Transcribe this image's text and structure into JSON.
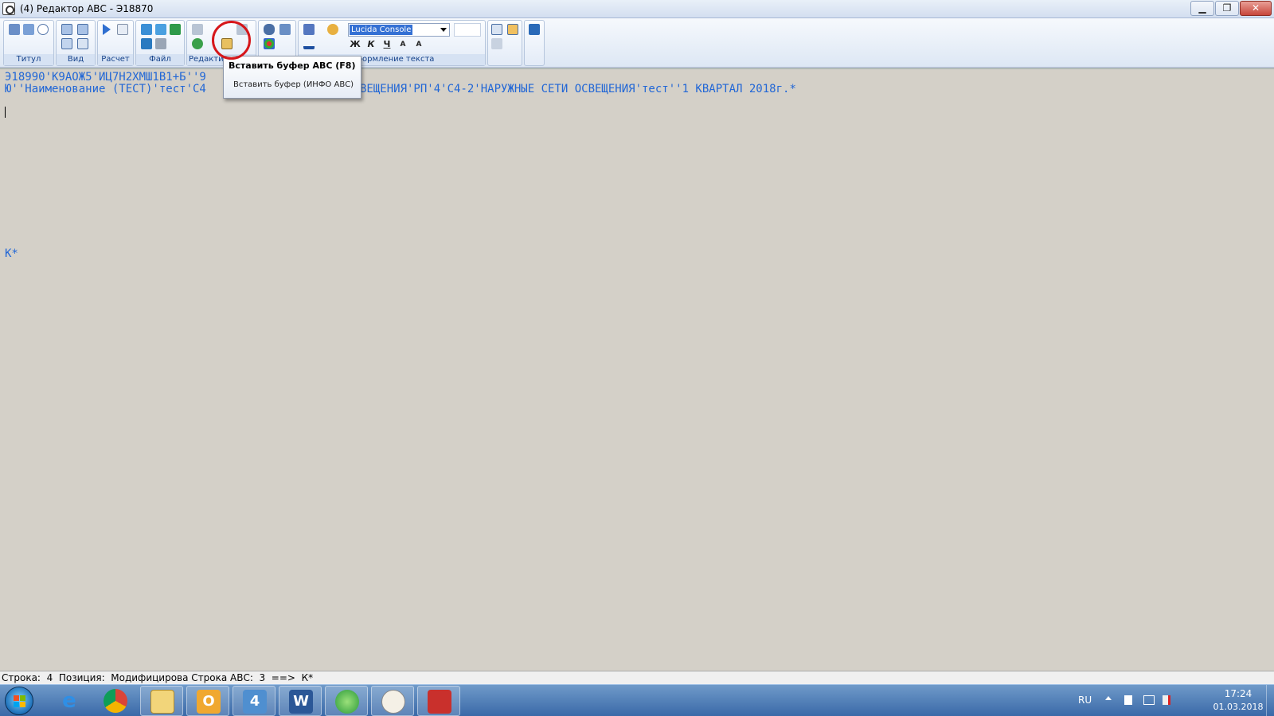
{
  "window": {
    "title": "(4) Редактор АВС - Э18870",
    "minimize": "▁",
    "restore": "❐",
    "close": "✕"
  },
  "ribbon": {
    "groups": [
      {
        "label": "Титул"
      },
      {
        "label": "Вид"
      },
      {
        "label": "Расчет"
      },
      {
        "label": "Файл"
      },
      {
        "label": "Редакти"
      },
      {
        "label": "Оформление текста"
      }
    ],
    "font_combo": {
      "value": "Lucida Console"
    },
    "format_buttons": [
      "Ж",
      "К",
      "Ч",
      "A",
      "A"
    ]
  },
  "tooltip": {
    "primary": "Вставить буфер АВС (F8)",
    "secondary": "Вставить буфер (ИНФО АВС)"
  },
  "editor": {
    "line1": "Э18990'К9АОЖ5'ИЦ7Н2ХМШ1В1+Б''9",
    "line2_left": "Ю''Наименование (ТЕСТ)'тест'С4",
    "line2_right": "ВЕЩЕНИЯ'РП'4'С4-2'НАРУЖНЫЕ СЕТИ ОСВЕЩЕНИЯ'тест''1 КВАРТАЛ 2018г.*",
    "line_k": "К*"
  },
  "statusbar": {
    "text": "Строка:  4  Позиция:  Модифицирова Строка АВС:  3  ==>  К*"
  },
  "taskbar": {
    "apps": [
      {
        "name": "ie-icon"
      },
      {
        "name": "chrome-icon"
      },
      {
        "name": "explorer-icon"
      },
      {
        "name": "outlook-icon",
        "label": "O"
      },
      {
        "name": "abc-editor-icon",
        "label": "4"
      },
      {
        "name": "word-icon",
        "label": "W"
      },
      {
        "name": "network-icon"
      },
      {
        "name": "paint-icon"
      },
      {
        "name": "pdf-icon"
      }
    ],
    "lang": "RU",
    "time": "17:24",
    "date": "01.03.2018"
  }
}
